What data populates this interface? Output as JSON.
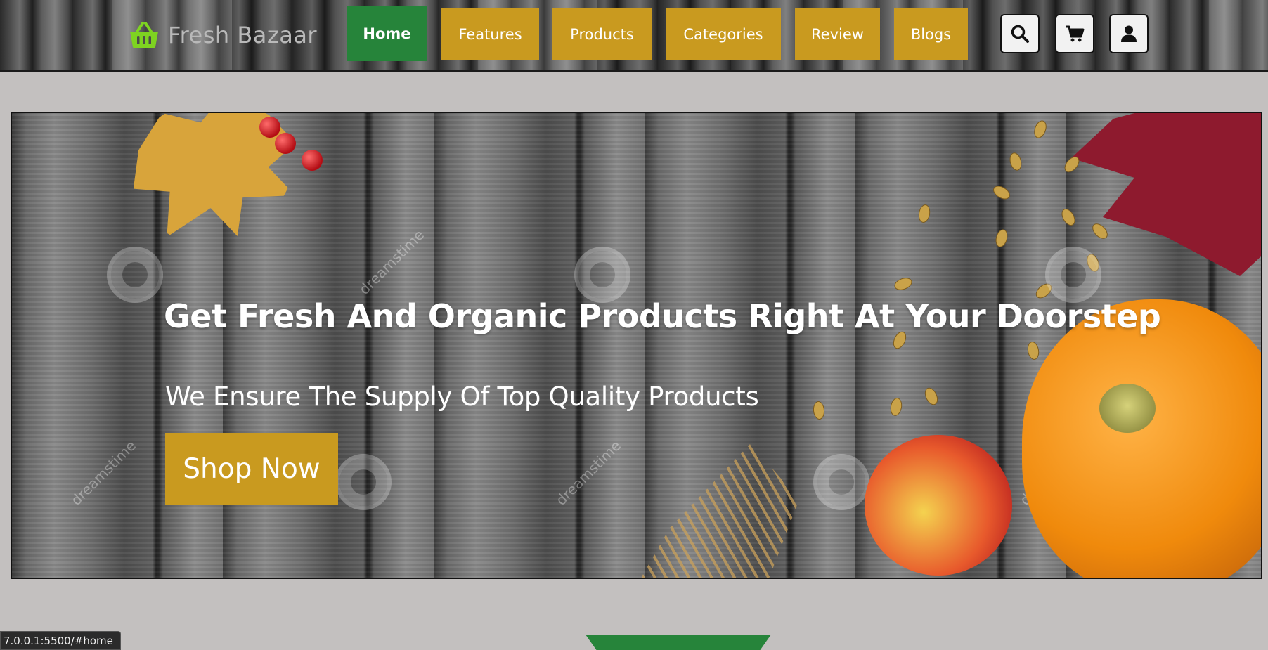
{
  "header": {
    "logo_text": "Fresh Bazaar",
    "nav": [
      {
        "label": "Home",
        "active": true
      },
      {
        "label": "Features",
        "active": false
      },
      {
        "label": "Products",
        "active": false
      },
      {
        "label": "Categories",
        "active": false
      },
      {
        "label": "Review",
        "active": false
      },
      {
        "label": "Blogs",
        "active": false
      }
    ],
    "icons": [
      "search-icon",
      "cart-icon",
      "user-icon"
    ]
  },
  "hero": {
    "title": "Get Fresh And Organic Products Right At Your Doorstep",
    "subtitle": "We Ensure The Supply Of Top Quality Products",
    "cta_label": "Shop Now",
    "watermark": "dreamstime"
  },
  "status_bar": {
    "url": "7.0.0.1:5500/#home"
  },
  "colors": {
    "accent_gold": "#c99a1f",
    "active_green": "#26843a",
    "logo_green": "#7ed321",
    "page_bg": "#c3c0bf"
  }
}
